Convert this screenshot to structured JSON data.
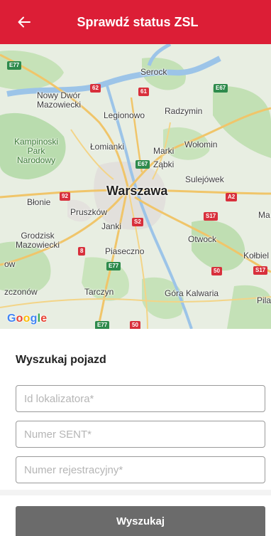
{
  "header": {
    "title": "Sprawdź status ZSL",
    "background_color": "#dc1e36",
    "back_icon": "arrow-left-icon"
  },
  "map": {
    "place_labels": [
      {
        "key": "serock",
        "text": "Serock"
      },
      {
        "key": "nowy_dwor",
        "text": "Nowy Dwór\nMazowiecki"
      },
      {
        "key": "legionowo",
        "text": "Legionowo"
      },
      {
        "key": "radzymin",
        "text": "Radzymin"
      },
      {
        "key": "kampinoski",
        "text": "Kampinoski\nPark\nNarodowy"
      },
      {
        "key": "lomianki",
        "text": "Łomianki"
      },
      {
        "key": "marki",
        "text": "Marki"
      },
      {
        "key": "wolomin",
        "text": "Wołomin"
      },
      {
        "key": "zabki",
        "text": "Ząbki"
      },
      {
        "key": "sulejowek",
        "text": "Sulejówek"
      },
      {
        "key": "warszawa",
        "text": "Warszawa"
      },
      {
        "key": "blonie",
        "text": "Błonie"
      },
      {
        "key": "ma",
        "text": "Ma"
      },
      {
        "key": "pruszkow",
        "text": "Pruszków"
      },
      {
        "key": "janki",
        "text": "Janki"
      },
      {
        "key": "grodzisk",
        "text": "Grodzisk\nMazowiecki"
      },
      {
        "key": "otwock",
        "text": "Otwock"
      },
      {
        "key": "piaseczno",
        "text": "Piaseczno"
      },
      {
        "key": "kolbiel",
        "text": "Kołbiel"
      },
      {
        "key": "ow",
        "text": "ow"
      },
      {
        "key": "zczonow",
        "text": "zczonów"
      },
      {
        "key": "tarczyn",
        "text": "Tarczyn"
      },
      {
        "key": "gora_kalwaria",
        "text": "Góra Kalwaria"
      },
      {
        "key": "pila",
        "text": "Pila"
      }
    ],
    "road_shields": [
      {
        "key": "e77_tl",
        "text": "E77"
      },
      {
        "key": "r62",
        "text": "62"
      },
      {
        "key": "r61",
        "text": "61"
      },
      {
        "key": "e67_ne",
        "text": "E67"
      },
      {
        "key": "e67_c",
        "text": "E67"
      },
      {
        "key": "r92",
        "text": "92"
      },
      {
        "key": "a2",
        "text": "A2"
      },
      {
        "key": "s17_a",
        "text": "S17"
      },
      {
        "key": "s2",
        "text": "S2"
      },
      {
        "key": "r8",
        "text": "8"
      },
      {
        "key": "e77_s",
        "text": "E77"
      },
      {
        "key": "r50",
        "text": "50"
      },
      {
        "key": "s17_b",
        "text": "S17"
      },
      {
        "key": "e77_b",
        "text": "E77"
      },
      {
        "key": "r50_b",
        "text": "50"
      }
    ],
    "attribution": "Google"
  },
  "search": {
    "section_title": "Wyszukaj pojazd",
    "locator_placeholder": "Id lokalizatora*",
    "sent_placeholder": "Numer SENT*",
    "registration_placeholder": "Numer rejestracyjny*",
    "locator_value": "",
    "sent_value": "",
    "registration_value": "",
    "button_label": "Wyszukaj"
  }
}
